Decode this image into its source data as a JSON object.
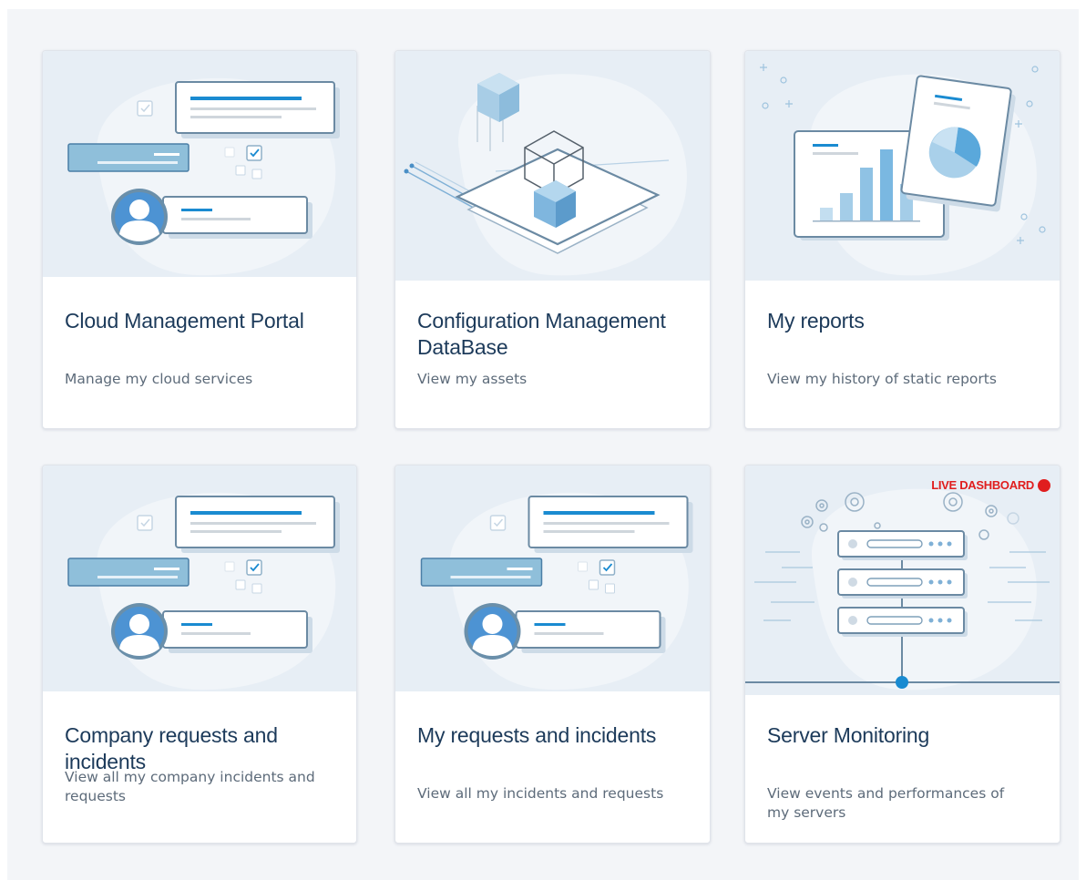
{
  "cards": [
    {
      "title": "Cloud Management Portal",
      "description": "Manage my cloud services"
    },
    {
      "title": "Configuration Management DataBase",
      "description": "View my assets"
    },
    {
      "title": "My reports",
      "description": "View my history of static reports"
    },
    {
      "title": "Company requests and incidents",
      "description": "View all my company incidents and requests"
    },
    {
      "title": "My requests and incidents",
      "description": "View all my incidents and requests"
    },
    {
      "title": "Server Monitoring",
      "description": "View events and performances of my servers",
      "badge": "LIVE DASHBOARD"
    }
  ],
  "colors": {
    "accent": "#1a8bd1",
    "title": "#1c3a5a",
    "live": "#e01e1e",
    "illustration_bg": "#e7eef5"
  }
}
